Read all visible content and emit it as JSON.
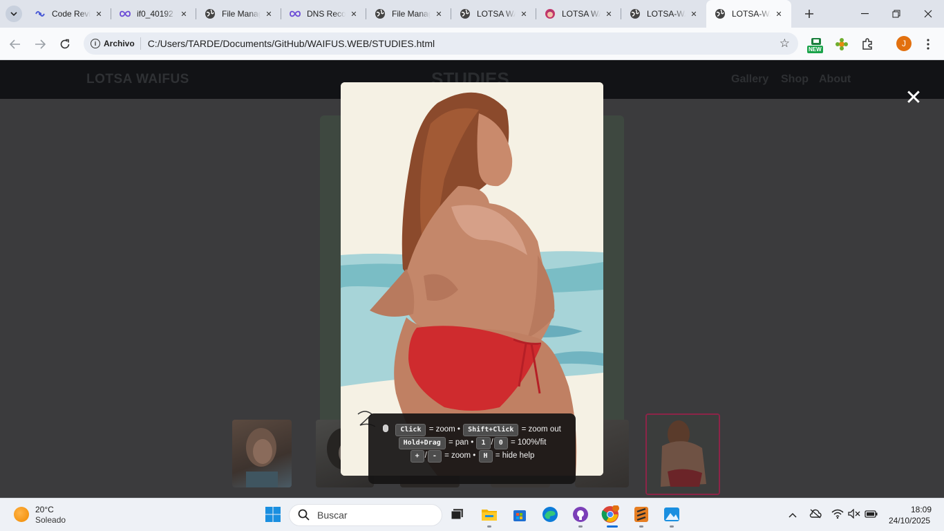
{
  "browser": {
    "tabs": [
      {
        "title": "Code Review",
        "icon": "devin-icon",
        "color": "#4b5bd6"
      },
      {
        "title": "if0_40192",
        "icon": "infinity-icon",
        "color": "#6b4bd6"
      },
      {
        "title": "File Manager",
        "icon": "globe-icon",
        "color": "#444444"
      },
      {
        "title": "DNS Records",
        "icon": "infinity-icon",
        "color": "#6b4bd6"
      },
      {
        "title": "File Manager",
        "icon": "globe-icon",
        "color": "#444444"
      },
      {
        "title": "LOTSA WAIFUS",
        "icon": "globe-icon",
        "color": "#444444"
      },
      {
        "title": "LOTSA WAIFUS",
        "icon": "ai-face-icon",
        "color": "#c2376b"
      },
      {
        "title": "LOTSA-WAIFUS",
        "icon": "globe-icon",
        "color": "#444444"
      },
      {
        "title": "LOTSA-WAIFUS",
        "icon": "globe-icon",
        "color": "#444444",
        "active": true
      }
    ],
    "address": {
      "chip": "Archivo",
      "url": "C:/Users/TARDE/Documents/GitHub/WAIFUS.WEB/STUDIES.html"
    },
    "ext_badge": "NEW",
    "profile_initial": "J"
  },
  "site": {
    "logo": "LOTSA WAIFUS",
    "title": "STUDIES",
    "nav": [
      "Gallery",
      "Shop",
      "About"
    ]
  },
  "lightbox": {
    "close_symbol": "✕",
    "help": {
      "click_key": "Click",
      "click_desc": "= zoom •",
      "shift_key": "Shift+Click",
      "shift_desc": "= zoom out",
      "drag_key": "Hold+Drag",
      "drag_desc": "= pan •",
      "key_1": "1",
      "slash": "/",
      "key_0": "0",
      "fit_desc": "= 100%/fit",
      "plus_key": "+",
      "minus_key": "-",
      "zoom_desc": "= zoom •",
      "h_key": "H",
      "hide_desc": "= hide help"
    }
  },
  "taskbar": {
    "weather_temp": "20°C",
    "weather_desc": "Soleado",
    "search_label": "Buscar",
    "time": "18:09",
    "date": "24/10/2025"
  },
  "colors": {
    "chrome_frame": "#dfe3eb",
    "page_overlay": "#3b3b3d",
    "accent_active_thumb": "#8d2448"
  }
}
